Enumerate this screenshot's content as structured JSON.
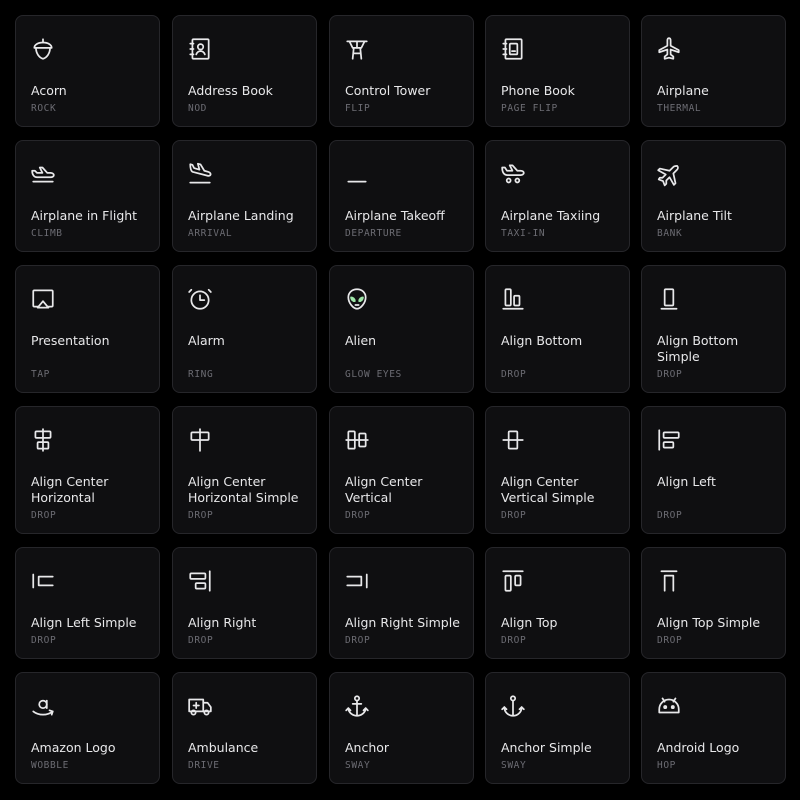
{
  "palette": {
    "background": "#000000",
    "card": "#0f0f11",
    "border": "#26262a",
    "text": "#e8e8ea",
    "muted": "#6c6c73",
    "accent": "#9ee6a8"
  },
  "icons": [
    {
      "name": "Acorn",
      "animation": "ROCK",
      "icon": "acorn-icon"
    },
    {
      "name": "Address Book",
      "animation": "NOD",
      "icon": "address-book-icon"
    },
    {
      "name": "Control Tower",
      "animation": "FLIP",
      "icon": "control-tower-icon"
    },
    {
      "name": "Phone Book",
      "animation": "PAGE FLIP",
      "icon": "phone-book-icon"
    },
    {
      "name": "Airplane",
      "animation": "THERMAL",
      "icon": "airplane-icon"
    },
    {
      "name": "Airplane in Flight",
      "animation": "CLIMB",
      "icon": "airplane-in-flight-icon"
    },
    {
      "name": "Airplane Landing",
      "animation": "ARRIVAL",
      "icon": "airplane-landing-icon"
    },
    {
      "name": "Airplane Takeoff",
      "animation": "DEPARTURE",
      "icon": "airplane-takeoff-icon"
    },
    {
      "name": "Airplane Taxiing",
      "animation": "TAXI-IN",
      "icon": "airplane-taxiing-icon"
    },
    {
      "name": "Airplane Tilt",
      "animation": "BANK",
      "icon": "airplane-tilt-icon"
    },
    {
      "name": "Presentation",
      "animation": "TAP",
      "icon": "presentation-icon"
    },
    {
      "name": "Alarm",
      "animation": "RING",
      "icon": "alarm-icon"
    },
    {
      "name": "Alien",
      "animation": "GLOW EYES",
      "icon": "alien-icon"
    },
    {
      "name": "Align Bottom",
      "animation": "DROP",
      "icon": "align-bottom-icon"
    },
    {
      "name": "Align Bottom Simple",
      "animation": "DROP",
      "icon": "align-bottom-simple-icon"
    },
    {
      "name": "Align Center Horizontal",
      "animation": "DROP",
      "icon": "align-center-horizontal-icon"
    },
    {
      "name": "Align Center Horizontal Simple",
      "animation": "DROP",
      "icon": "align-center-horizontal-simple-icon"
    },
    {
      "name": "Align Center Vertical",
      "animation": "DROP",
      "icon": "align-center-vertical-icon"
    },
    {
      "name": "Align Center Vertical Simple",
      "animation": "DROP",
      "icon": "align-center-vertical-simple-icon"
    },
    {
      "name": "Align Left",
      "animation": "DROP",
      "icon": "align-left-icon"
    },
    {
      "name": "Align Left Simple",
      "animation": "DROP",
      "icon": "align-left-simple-icon"
    },
    {
      "name": "Align Right",
      "animation": "DROP",
      "icon": "align-right-icon"
    },
    {
      "name": "Align Right Simple",
      "animation": "DROP",
      "icon": "align-right-simple-icon"
    },
    {
      "name": "Align Top",
      "animation": "DROP",
      "icon": "align-top-icon"
    },
    {
      "name": "Align Top Simple",
      "animation": "DROP",
      "icon": "align-top-simple-icon"
    },
    {
      "name": "Amazon Logo",
      "animation": "WOBBLE",
      "icon": "amazon-logo-icon"
    },
    {
      "name": "Ambulance",
      "animation": "DRIVE",
      "icon": "ambulance-icon"
    },
    {
      "name": "Anchor",
      "animation": "SWAY",
      "icon": "anchor-icon"
    },
    {
      "name": "Anchor Simple",
      "animation": "SWAY",
      "icon": "anchor-simple-icon"
    },
    {
      "name": "Android Logo",
      "animation": "HOP",
      "icon": "android-logo-icon"
    }
  ]
}
